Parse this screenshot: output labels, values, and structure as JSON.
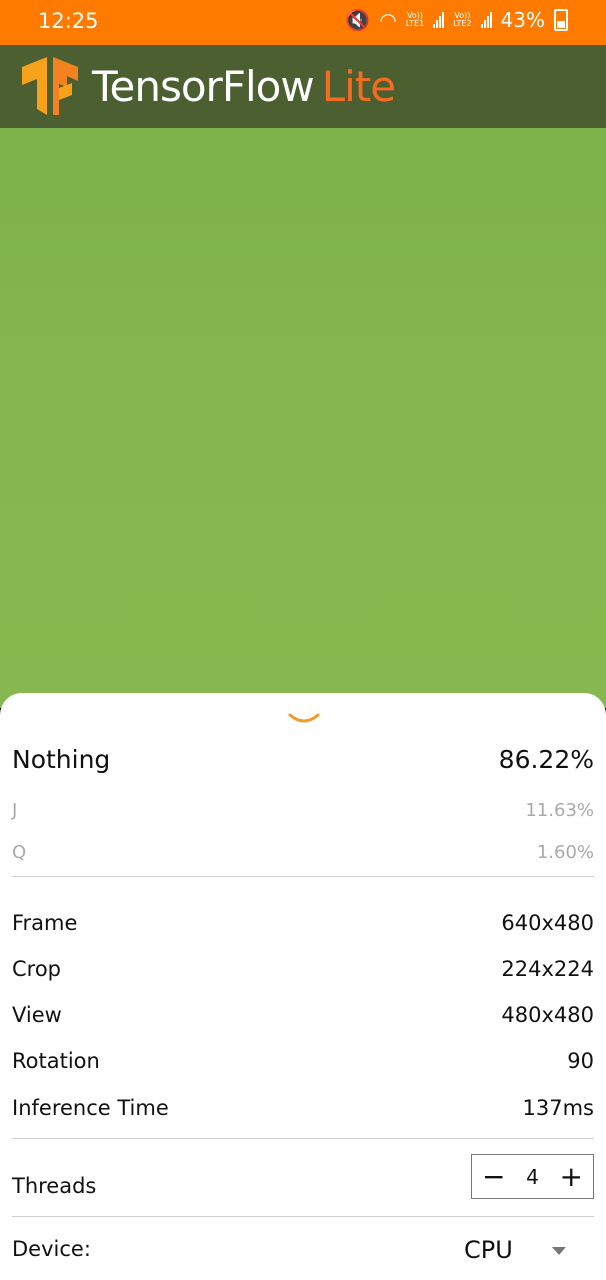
{
  "status_bar": {
    "time": "12:25",
    "battery": "43%",
    "sim1_label_top": "Vo))",
    "sim1_label_bottom": "LTE1",
    "sim2_label_top": "Vo))",
    "sim2_label_bottom": "LTE2"
  },
  "app_bar": {
    "brand_main": "TensorFlow",
    "brand_accent": "Lite",
    "brand_accent_color": "#f46b22",
    "background_color": "#4b5f31"
  },
  "results": [
    {
      "label": "Nothing",
      "value": "86.22%"
    },
    {
      "label": "J",
      "value": "11.63%"
    },
    {
      "label": "Q",
      "value": "1.60%"
    }
  ],
  "info": [
    {
      "label": "Frame",
      "value": "640x480"
    },
    {
      "label": "Crop",
      "value": "224x224"
    },
    {
      "label": "View",
      "value": "480x480"
    },
    {
      "label": "Rotation",
      "value": "90"
    },
    {
      "label": "Inference Time",
      "value": "137ms"
    }
  ],
  "threads": {
    "label": "Threads",
    "value": "4",
    "minus": "−",
    "plus": "+"
  },
  "device": {
    "label": "Device:",
    "value": "CPU"
  },
  "colors": {
    "status_bar": "#ff7b00",
    "camera_bg": "#82b64c",
    "chevron": "#f39a2a"
  }
}
